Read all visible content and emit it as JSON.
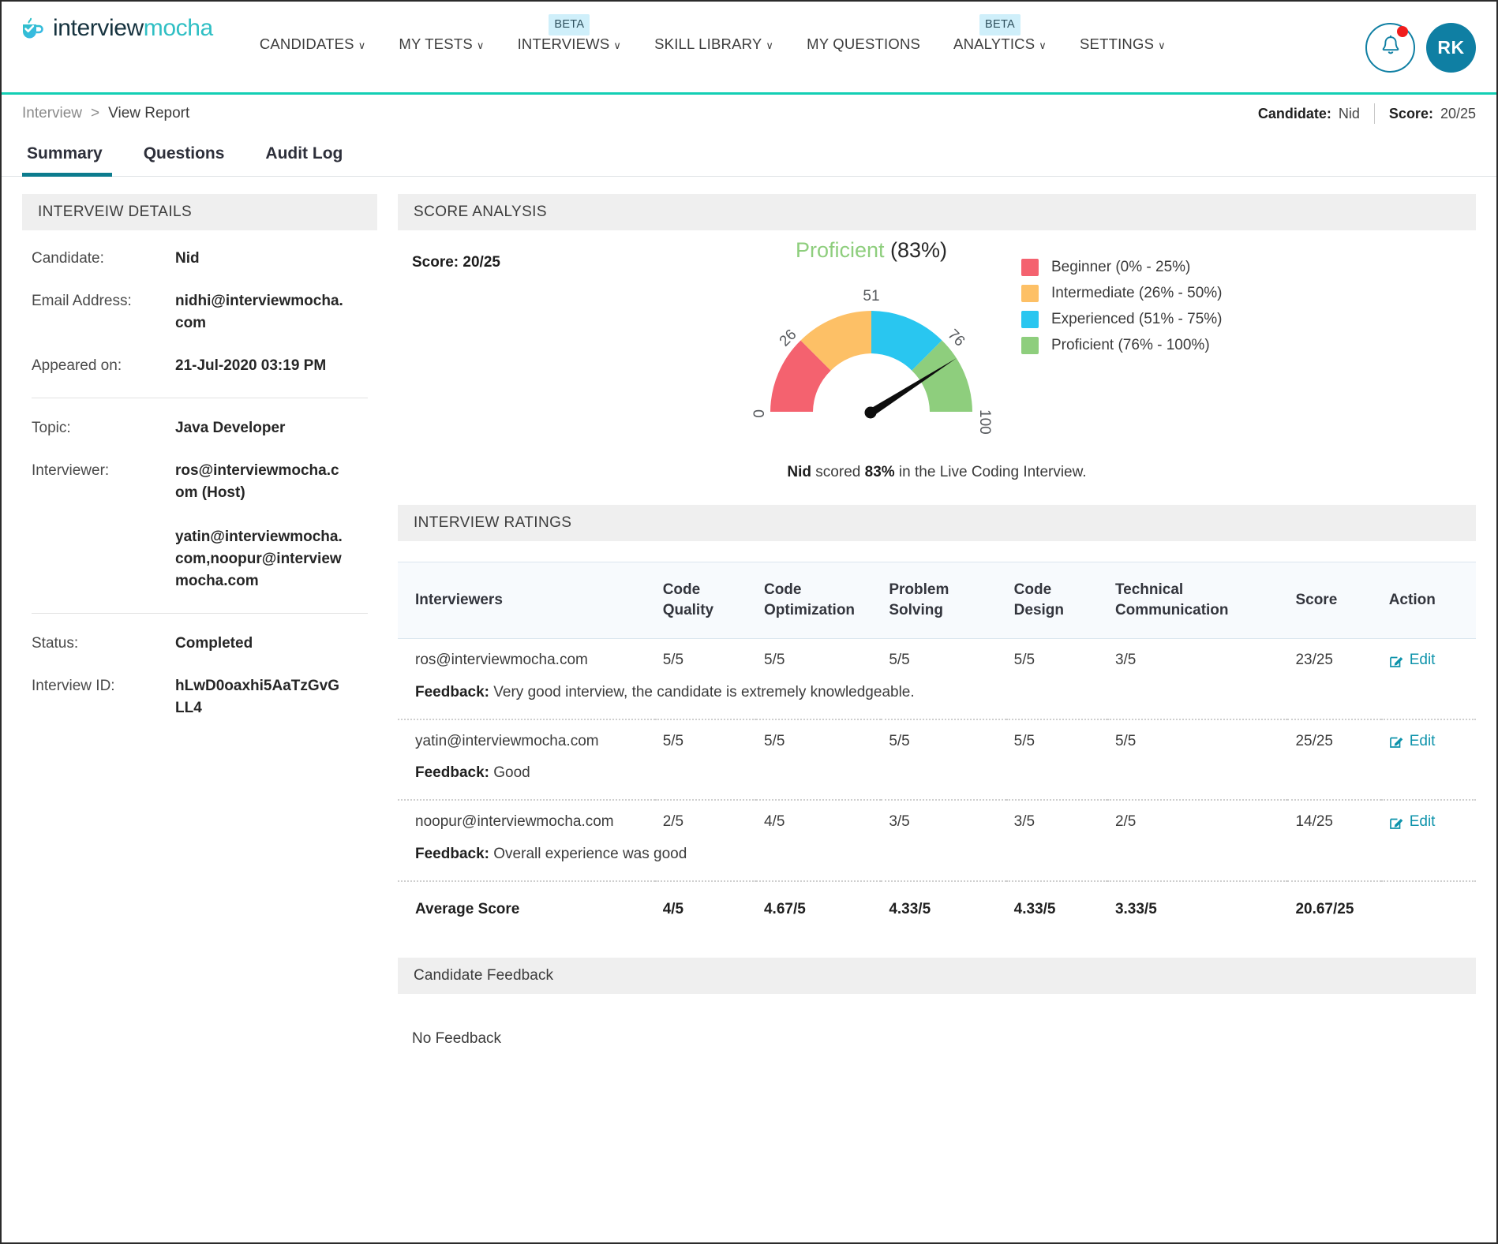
{
  "brand": {
    "name_part1": "interview",
    "name_part2": "mocha",
    "logo_icon": "coffee-cup-check-icon",
    "accent_teal": "#13cfb4",
    "accent_blue": "#0f7fa3"
  },
  "nav": {
    "items": [
      {
        "label": "CANDIDATES",
        "caret": "∨",
        "badge": null
      },
      {
        "label": "MY TESTS",
        "caret": "∨",
        "badge": null
      },
      {
        "label": "INTERVIEWS",
        "caret": "∨",
        "badge": "BETA"
      },
      {
        "label": "SKILL LIBRARY",
        "caret": "∨",
        "badge": null
      },
      {
        "label": "MY QUESTIONS",
        "caret": "",
        "badge": null
      },
      {
        "label": "ANALYTICS",
        "caret": "∨",
        "badge": "BETA"
      },
      {
        "label": "SETTINGS",
        "caret": "∨",
        "badge": null
      }
    ],
    "bell_icon": "notification-bell-icon",
    "bell_has_alert": true,
    "avatar_initials": "RK"
  },
  "breadcrumb": {
    "parent": "Interview",
    "separator": ">",
    "current": "View Report",
    "candidate_label": "Candidate:",
    "candidate_value": "Nid",
    "score_label": "Score:",
    "score_value": "20/25"
  },
  "tabs": [
    {
      "label": "Summary",
      "active": true
    },
    {
      "label": "Questions",
      "active": false
    },
    {
      "label": "Audit Log",
      "active": false
    }
  ],
  "interview_details": {
    "panel_title": "INTERVEIW DETAILS",
    "rows_top": [
      {
        "label": "Candidate:",
        "value": "Nid"
      },
      {
        "label": "Email Address:",
        "value": "nidhi@interviewmocha.com"
      },
      {
        "label": "Appeared on:",
        "value": "21-Jul-2020 03:19 PM"
      }
    ],
    "rows_mid": [
      {
        "label": "Topic:",
        "value": "Java Developer"
      },
      {
        "label": "Interviewer:",
        "value": "ros@interviewmocha.com (Host)"
      }
    ],
    "interviewer_extra": "yatin@interviewmocha.com,noopur@interviewmocha.com",
    "rows_bottom": [
      {
        "label": "Status:",
        "value": "Completed"
      },
      {
        "label": "Interview ID:",
        "value": "hLwD0oaxhi5AaTzGvGLL4"
      }
    ]
  },
  "score_analysis": {
    "panel_title": "SCORE ANALYSIS",
    "score_label": "Score:",
    "score_value": "20/25",
    "gauge_level": "Proficient",
    "gauge_percent_text": "(83%)",
    "note_name": "Nid",
    "note_mid": " scored ",
    "note_percent": "83%",
    "note_tail": " in the Live Coding Interview.",
    "legend": [
      {
        "label": "Beginner (0% - 25%)",
        "color": "#f4626f"
      },
      {
        "label": "Intermediate (26% - 50%)",
        "color": "#fdc066"
      },
      {
        "label": "Experienced (51% - 75%)",
        "color": "#29c6f0"
      },
      {
        "label": "Proficient (76% - 100%)",
        "color": "#8ece7d"
      }
    ]
  },
  "chart_data": {
    "type": "gauge",
    "title": "Proficient (83%)",
    "value": 83,
    "min": 0,
    "max": 100,
    "tick_labels": [
      "0",
      "26",
      "51",
      "76",
      "100"
    ],
    "tick_values": [
      0,
      26,
      51,
      76,
      100
    ],
    "needle_color": "#000000",
    "segments": [
      {
        "name": "Beginner",
        "from": 0,
        "to": 25,
        "color": "#f4626f"
      },
      {
        "name": "Intermediate",
        "from": 25,
        "to": 50,
        "color": "#fdc066"
      },
      {
        "name": "Experienced",
        "from": 50,
        "to": 75,
        "color": "#29c6f0"
      },
      {
        "name": "Proficient",
        "from": 75,
        "to": 100,
        "color": "#8ece7d"
      }
    ]
  },
  "interview_ratings": {
    "panel_title": "INTERVIEW RATINGS",
    "columns": [
      "Interviewers",
      "Code Quality",
      "Code Optimization",
      "Problem Solving",
      "Code Design",
      "Technical Communication",
      "Score",
      "Action"
    ],
    "feedback_label": "Feedback:",
    "action_label": "Edit",
    "action_icon": "edit-pencil-icon",
    "rows": [
      {
        "interviewer": "ros@interviewmocha.com",
        "code_quality": "5/5",
        "code_optimization": "5/5",
        "problem_solving": "5/5",
        "code_design": "5/5",
        "technical_communication": "3/5",
        "score": "23/25",
        "feedback": "Very good interview, the candidate is extremely knowledgeable."
      },
      {
        "interviewer": "yatin@interviewmocha.com",
        "code_quality": "5/5",
        "code_optimization": "5/5",
        "problem_solving": "5/5",
        "code_design": "5/5",
        "technical_communication": "5/5",
        "score": "25/25",
        "feedback": "Good"
      },
      {
        "interviewer": "noopur@interviewmocha.com",
        "code_quality": "2/5",
        "code_optimization": "4/5",
        "problem_solving": "3/5",
        "code_design": "3/5",
        "technical_communication": "2/5",
        "score": "14/25",
        "feedback": "Overall experience was good"
      }
    ],
    "average": {
      "label": "Average Score",
      "code_quality": "4/5",
      "code_optimization": "4.67/5",
      "problem_solving": "4.33/5",
      "code_design": "4.33/5",
      "technical_communication": "3.33/5",
      "score": "20.67/25"
    }
  },
  "candidate_feedback": {
    "panel_title": "Candidate Feedback",
    "body": "No Feedback"
  }
}
